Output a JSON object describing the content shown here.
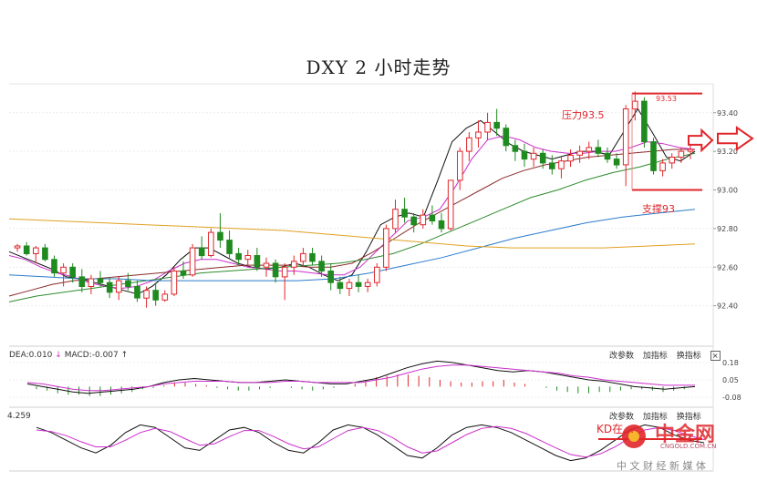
{
  "chart_data": {
    "type": "candlestick",
    "title": "DXY 2 小时走势",
    "ylim": [
      92.2,
      93.55
    ],
    "yticks": [
      "93.40",
      "93.20",
      "93.00",
      "92.80",
      "92.60",
      "92.40"
    ],
    "candles": [
      [
        92.7,
        92.72,
        92.68,
        92.71
      ],
      [
        92.71,
        92.73,
        92.66,
        92.67
      ],
      [
        92.67,
        92.71,
        92.62,
        92.7
      ],
      [
        92.7,
        92.72,
        92.63,
        92.64
      ],
      [
        92.64,
        92.66,
        92.55,
        92.57
      ],
      [
        92.57,
        92.62,
        92.5,
        92.6
      ],
      [
        92.6,
        92.62,
        92.52,
        92.55
      ],
      [
        92.55,
        92.59,
        92.47,
        92.5
      ],
      [
        92.5,
        92.56,
        92.46,
        92.54
      ],
      [
        92.54,
        92.58,
        92.5,
        92.52
      ],
      [
        92.52,
        92.55,
        92.44,
        92.47
      ],
      [
        92.47,
        92.55,
        92.43,
        92.53
      ],
      [
        92.53,
        92.57,
        92.48,
        92.5
      ],
      [
        92.5,
        92.53,
        92.42,
        92.44
      ],
      [
        92.44,
        92.5,
        92.39,
        92.48
      ],
      [
        92.48,
        92.52,
        92.4,
        92.43
      ],
      [
        92.43,
        92.48,
        92.42,
        92.46
      ],
      [
        92.46,
        92.6,
        92.45,
        92.58
      ],
      [
        92.58,
        92.63,
        92.54,
        92.56
      ],
      [
        92.56,
        92.72,
        92.55,
        92.7
      ],
      [
        92.7,
        92.76,
        92.64,
        92.66
      ],
      [
        92.66,
        92.8,
        92.65,
        92.78
      ],
      [
        92.78,
        92.88,
        92.7,
        92.74
      ],
      [
        92.74,
        92.79,
        92.64,
        92.67
      ],
      [
        92.67,
        92.7,
        92.61,
        92.64
      ],
      [
        92.64,
        92.69,
        92.6,
        92.66
      ],
      [
        92.66,
        92.7,
        92.58,
        92.6
      ],
      [
        92.6,
        92.65,
        92.55,
        92.62
      ],
      [
        92.62,
        92.64,
        92.52,
        92.55
      ],
      [
        92.55,
        92.62,
        92.43,
        92.6
      ],
      [
        92.6,
        92.66,
        92.56,
        92.63
      ],
      [
        92.63,
        92.7,
        92.6,
        92.67
      ],
      [
        92.67,
        92.7,
        92.61,
        92.63
      ],
      [
        92.63,
        92.66,
        92.55,
        92.58
      ],
      [
        92.58,
        92.62,
        92.48,
        92.52
      ],
      [
        92.52,
        92.55,
        92.46,
        92.49
      ],
      [
        92.49,
        92.54,
        92.45,
        92.52
      ],
      [
        92.52,
        92.56,
        92.47,
        92.5
      ],
      [
        92.5,
        92.54,
        92.47,
        92.52
      ],
      [
        92.52,
        92.62,
        92.5,
        92.6
      ],
      [
        92.6,
        92.82,
        92.58,
        92.8
      ],
      [
        92.8,
        92.95,
        92.78,
        92.9
      ],
      [
        92.9,
        92.96,
        92.83,
        92.86
      ],
      [
        92.86,
        92.88,
        92.78,
        92.82
      ],
      [
        92.82,
        92.9,
        92.8,
        92.87
      ],
      [
        92.87,
        92.92,
        92.82,
        92.84
      ],
      [
        92.84,
        92.88,
        92.78,
        92.8
      ],
      [
        92.8,
        92.95,
        92.79,
        93.05
      ],
      [
        93.05,
        93.22,
        93.0,
        93.2
      ],
      [
        93.2,
        93.3,
        93.15,
        93.27
      ],
      [
        93.27,
        93.36,
        93.22,
        93.3
      ],
      [
        93.3,
        93.4,
        93.26,
        93.35
      ],
      [
        93.35,
        93.42,
        93.28,
        93.32
      ],
      [
        93.32,
        93.34,
        93.2,
        93.23
      ],
      [
        93.23,
        93.26,
        93.15,
        93.2
      ],
      [
        93.2,
        93.24,
        93.12,
        93.16
      ],
      [
        93.16,
        93.22,
        93.12,
        93.19
      ],
      [
        93.19,
        93.21,
        93.11,
        93.14
      ],
      [
        93.14,
        93.18,
        93.08,
        93.11
      ],
      [
        93.11,
        93.17,
        93.06,
        93.15
      ],
      [
        93.15,
        93.21,
        93.12,
        93.18
      ],
      [
        93.18,
        93.23,
        93.14,
        93.2
      ],
      [
        93.2,
        93.25,
        93.16,
        93.22
      ],
      [
        93.22,
        93.26,
        93.17,
        93.19
      ],
      [
        93.19,
        93.22,
        93.14,
        93.16
      ],
      [
        93.16,
        93.19,
        93.11,
        93.13
      ],
      [
        93.13,
        93.44,
        93.02,
        93.42
      ],
      [
        93.42,
        93.51,
        93.36,
        93.46
      ],
      [
        93.46,
        93.48,
        93.22,
        93.25
      ],
      [
        93.25,
        93.27,
        93.08,
        93.1
      ],
      [
        93.1,
        93.16,
        93.07,
        93.14
      ],
      [
        93.14,
        93.19,
        93.11,
        93.17
      ],
      [
        93.17,
        93.22,
        93.14,
        93.2
      ],
      [
        93.2,
        93.24,
        93.16,
        93.21
      ]
    ],
    "ma_lines": [
      {
        "color": "#111111",
        "values": [
          92.68,
          92.65,
          92.62,
          92.59,
          92.55,
          92.54,
          92.52,
          92.5,
          92.48,
          92.46,
          92.5,
          92.56,
          92.64,
          92.7,
          92.7,
          92.66,
          92.62,
          92.6,
          92.59,
          92.6,
          92.62,
          92.6,
          92.56,
          92.53,
          92.56,
          92.68,
          92.82,
          92.86,
          92.88,
          92.86,
          93.05,
          93.25,
          93.32,
          93.36,
          93.3,
          93.24,
          93.2,
          93.18,
          93.16,
          93.18,
          93.2,
          93.2,
          93.18,
          93.3,
          93.42,
          93.3,
          93.17,
          93.15,
          93.2
        ]
      },
      {
        "color": "#cc2ecc",
        "values": [
          92.66,
          92.64,
          92.6,
          92.57,
          92.55,
          92.52,
          92.5,
          92.49,
          92.5,
          92.53,
          92.58,
          92.62,
          92.64,
          92.64,
          92.62,
          92.6,
          92.59,
          92.58,
          92.58,
          92.57,
          92.56,
          92.56,
          92.6,
          92.68,
          92.76,
          92.84,
          92.86,
          92.9,
          93.02,
          93.16,
          93.26,
          93.28,
          93.26,
          93.22,
          93.2,
          93.19,
          93.19,
          93.2,
          93.2,
          93.22,
          93.25,
          93.24,
          93.22,
          93.21
        ]
      },
      {
        "color": "#8b2a2a",
        "values": [
          92.45,
          92.48,
          92.51,
          92.53,
          92.54,
          92.55,
          92.56,
          92.57,
          92.58,
          92.59,
          92.6,
          92.61,
          92.61,
          92.61,
          92.6,
          92.6,
          92.62,
          92.68,
          92.75,
          92.82,
          92.88,
          92.94,
          93.0,
          93.06,
          93.1,
          93.13,
          93.15,
          93.17,
          93.18,
          93.19,
          93.2,
          93.21,
          93.21
        ]
      },
      {
        "color": "#2e8b2e",
        "values": [
          92.42,
          92.45,
          92.47,
          92.49,
          92.51,
          92.53,
          92.55,
          92.57,
          92.58,
          92.59,
          92.6,
          92.61,
          92.62,
          92.64,
          92.67,
          92.72,
          92.78,
          92.84,
          92.9,
          92.96,
          93.0,
          93.05,
          93.09,
          93.12,
          93.16,
          93.19
        ]
      },
      {
        "color": "#2b7bcc",
        "values": [
          92.56,
          92.55,
          92.54,
          92.54,
          92.53,
          92.53,
          92.53,
          92.53,
          92.53,
          92.54,
          92.57,
          92.61,
          92.65,
          92.7,
          92.75,
          92.79,
          92.83,
          92.86,
          92.88,
          92.9
        ]
      },
      {
        "color": "#e0a020",
        "values": [
          92.85,
          92.84,
          92.83,
          92.82,
          92.81,
          92.8,
          92.79,
          92.77,
          92.75,
          92.73,
          92.71,
          92.7,
          92.7,
          92.7,
          92.71,
          92.72
        ]
      }
    ],
    "resistance_label": "压力93.5",
    "resistance_value": 93.5,
    "resistance_price": "93.53",
    "support_label": "支撑93",
    "support_value": 93.0,
    "macd": {
      "label": "DEA:0.010",
      "label2": "MACD:-0.007",
      "yticks": [
        "0.18",
        "0.05",
        "-0.08"
      ],
      "ylim": [
        -0.12,
        0.22
      ],
      "hist": [
        -0.02,
        -0.03,
        -0.05,
        -0.06,
        -0.06,
        -0.07,
        -0.07,
        -0.06,
        -0.05,
        -0.04,
        -0.02,
        -0.01,
        0.01,
        0.03,
        0.03,
        0.02,
        0.01,
        -0.01,
        -0.02,
        -0.03,
        -0.03,
        -0.02,
        -0.01,
        0.0,
        -0.01,
        -0.02,
        -0.03,
        -0.02,
        -0.01,
        0.0,
        0.02,
        0.05,
        0.07,
        0.08,
        0.09,
        0.09,
        0.08,
        0.07,
        0.05,
        0.04,
        0.03,
        0.03,
        0.04,
        0.04,
        0.05,
        0.03,
        0.02,
        0.0,
        -0.01,
        -0.03,
        -0.04,
        -0.05,
        -0.05,
        -0.04,
        -0.04,
        -0.03,
        -0.02,
        -0.02,
        -0.03,
        -0.04,
        -0.03,
        -0.02
      ],
      "dif": [
        0.02,
        0.0,
        -0.02,
        -0.04,
        -0.05,
        -0.04,
        -0.03,
        -0.02,
        0.0,
        0.03,
        0.05,
        0.06,
        0.05,
        0.04,
        0.03,
        0.03,
        0.04,
        0.05,
        0.04,
        0.03,
        0.02,
        0.02,
        0.04,
        0.06,
        0.1,
        0.14,
        0.17,
        0.19,
        0.18,
        0.16,
        0.14,
        0.12,
        0.11,
        0.12,
        0.11,
        0.09,
        0.07,
        0.05,
        0.04,
        0.02,
        0.0,
        -0.01,
        -0.02,
        -0.01,
        0.0
      ],
      "dea": [
        0.03,
        0.02,
        0.0,
        -0.02,
        -0.03,
        -0.03,
        -0.02,
        -0.01,
        0.0,
        0.02,
        0.03,
        0.04,
        0.04,
        0.04,
        0.03,
        0.03,
        0.03,
        0.04,
        0.04,
        0.03,
        0.03,
        0.03,
        0.03,
        0.05,
        0.07,
        0.1,
        0.13,
        0.15,
        0.16,
        0.16,
        0.15,
        0.14,
        0.13,
        0.12,
        0.11,
        0.1,
        0.08,
        0.07,
        0.05,
        0.04,
        0.03,
        0.02,
        0.01,
        0.01,
        0.01
      ]
    },
    "kdj": {
      "label": "4.259",
      "k": [
        80,
        70,
        55,
        40,
        30,
        45,
        70,
        85,
        80,
        60,
        40,
        35,
        55,
        75,
        80,
        70,
        50,
        35,
        30,
        50,
        75,
        85,
        80,
        65,
        45,
        25,
        20,
        40,
        65,
        80,
        85,
        80,
        70,
        55,
        40,
        25,
        15,
        20,
        35,
        55,
        75,
        85,
        80,
        65,
        55,
        50
      ],
      "d": [
        75,
        72,
        64,
        52,
        42,
        42,
        55,
        70,
        78,
        72,
        58,
        45,
        48,
        62,
        74,
        74,
        62,
        48,
        38,
        42,
        58,
        74,
        80,
        74,
        60,
        42,
        30,
        34,
        50,
        66,
        78,
        82,
        78,
        68,
        54,
        40,
        27,
        22,
        28,
        42,
        60,
        75,
        80,
        74,
        64,
        56
      ]
    },
    "kd_annotation": "KD在…"
  },
  "indicator_tools": {
    "change_params": "改参数",
    "add_indicator": "加指标",
    "switch_indicator": "换指标",
    "close": "×"
  },
  "watermark": {
    "brand": "中金网",
    "domain": "CNGOLD.COM.CN",
    "slogan": "中 文 财 经 新 媒 体"
  },
  "colors": {
    "up": "#e0262b",
    "down": "#1f8a1f",
    "annotation": "#e0262b",
    "arrow": "#e0262b"
  }
}
